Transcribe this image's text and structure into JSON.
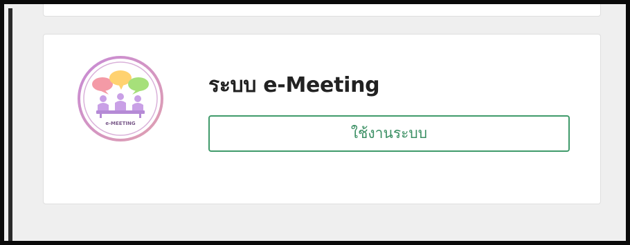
{
  "card": {
    "title": "ระบบ e-Meeting",
    "button_label": "ใช้งานระบบ",
    "logo_text": "e-MEETING"
  },
  "colors": {
    "page_background": "#efefef",
    "card_background": "#ffffff",
    "button_border": "#3f9a6a",
    "button_text": "#3a8f63",
    "title_text": "#222222",
    "logo_ring": "#c07ac0",
    "logo_people": "#c9a0e6",
    "bubble_pink": "#f49aa6",
    "bubble_yellow": "#ffd270",
    "bubble_green": "#a6e07a"
  }
}
